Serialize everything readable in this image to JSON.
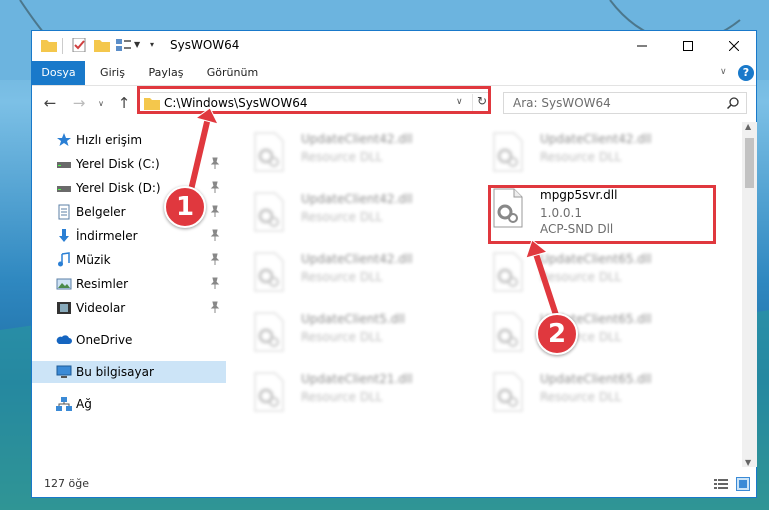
{
  "window": {
    "title": "SysWOW64"
  },
  "ribbon": {
    "tabs": [
      "Dosya",
      "Giriş",
      "Paylaş",
      "Görünüm"
    ]
  },
  "nav": {
    "address_path": "C:\\Windows\\SysWOW64",
    "search_placeholder": "Ara: SysWOW64"
  },
  "sidebar": {
    "items": [
      {
        "label": "Hızlı erişim",
        "icon": "star-icon"
      },
      {
        "label": "Yerel Disk (C:)",
        "icon": "drive-icon",
        "pinned": true
      },
      {
        "label": "Yerel Disk (D:)",
        "icon": "drive-icon",
        "pinned": true
      },
      {
        "label": "Belgeler",
        "icon": "documents-icon",
        "pinned": true
      },
      {
        "label": "İndirmeler",
        "icon": "download-icon",
        "pinned": true
      },
      {
        "label": "Müzik",
        "icon": "music-icon",
        "pinned": true
      },
      {
        "label": "Resimler",
        "icon": "pictures-icon",
        "pinned": true
      },
      {
        "label": "Videolar",
        "icon": "videos-icon",
        "pinned": true
      },
      {
        "label": "OneDrive",
        "icon": "cloud-icon"
      },
      {
        "label": "Bu bilgisayar",
        "icon": "computer-icon",
        "selected": true
      },
      {
        "label": "Ağ",
        "icon": "network-icon"
      }
    ]
  },
  "files": [
    {
      "name": "UpdateClient42.dll",
      "desc": "Resource DLL"
    },
    {
      "name": "UpdateClient42.dll",
      "desc": "Resource DLL"
    },
    {
      "name": "UpdateClient42.dll",
      "desc": "Resource DLL"
    },
    {
      "name": "mpgp5svr.dll",
      "version": "1.0.0.1",
      "desc": "ACP-SND Dll"
    },
    {
      "name": "UpdateClient42.dll",
      "desc": "Resource DLL"
    },
    {
      "name": "UpdateClient65.dll",
      "desc": "Resource DLL"
    },
    {
      "name": "UpdateClient5.dll",
      "desc": "Resource DLL"
    },
    {
      "name": "UpdateClient65.dll",
      "desc": "Resource DLL"
    },
    {
      "name": "UpdateClient21.dll",
      "desc": "Resource DLL"
    },
    {
      "name": "UpdateClient65.dll",
      "desc": "Resource DLL"
    }
  ],
  "status": {
    "item_count": "127 öğe"
  },
  "annotations": {
    "badge1": "1",
    "badge2": "2",
    "color": "#e0383e"
  },
  "colors": {
    "accent": "#1979ca",
    "selected_bg": "#cce4f7"
  }
}
